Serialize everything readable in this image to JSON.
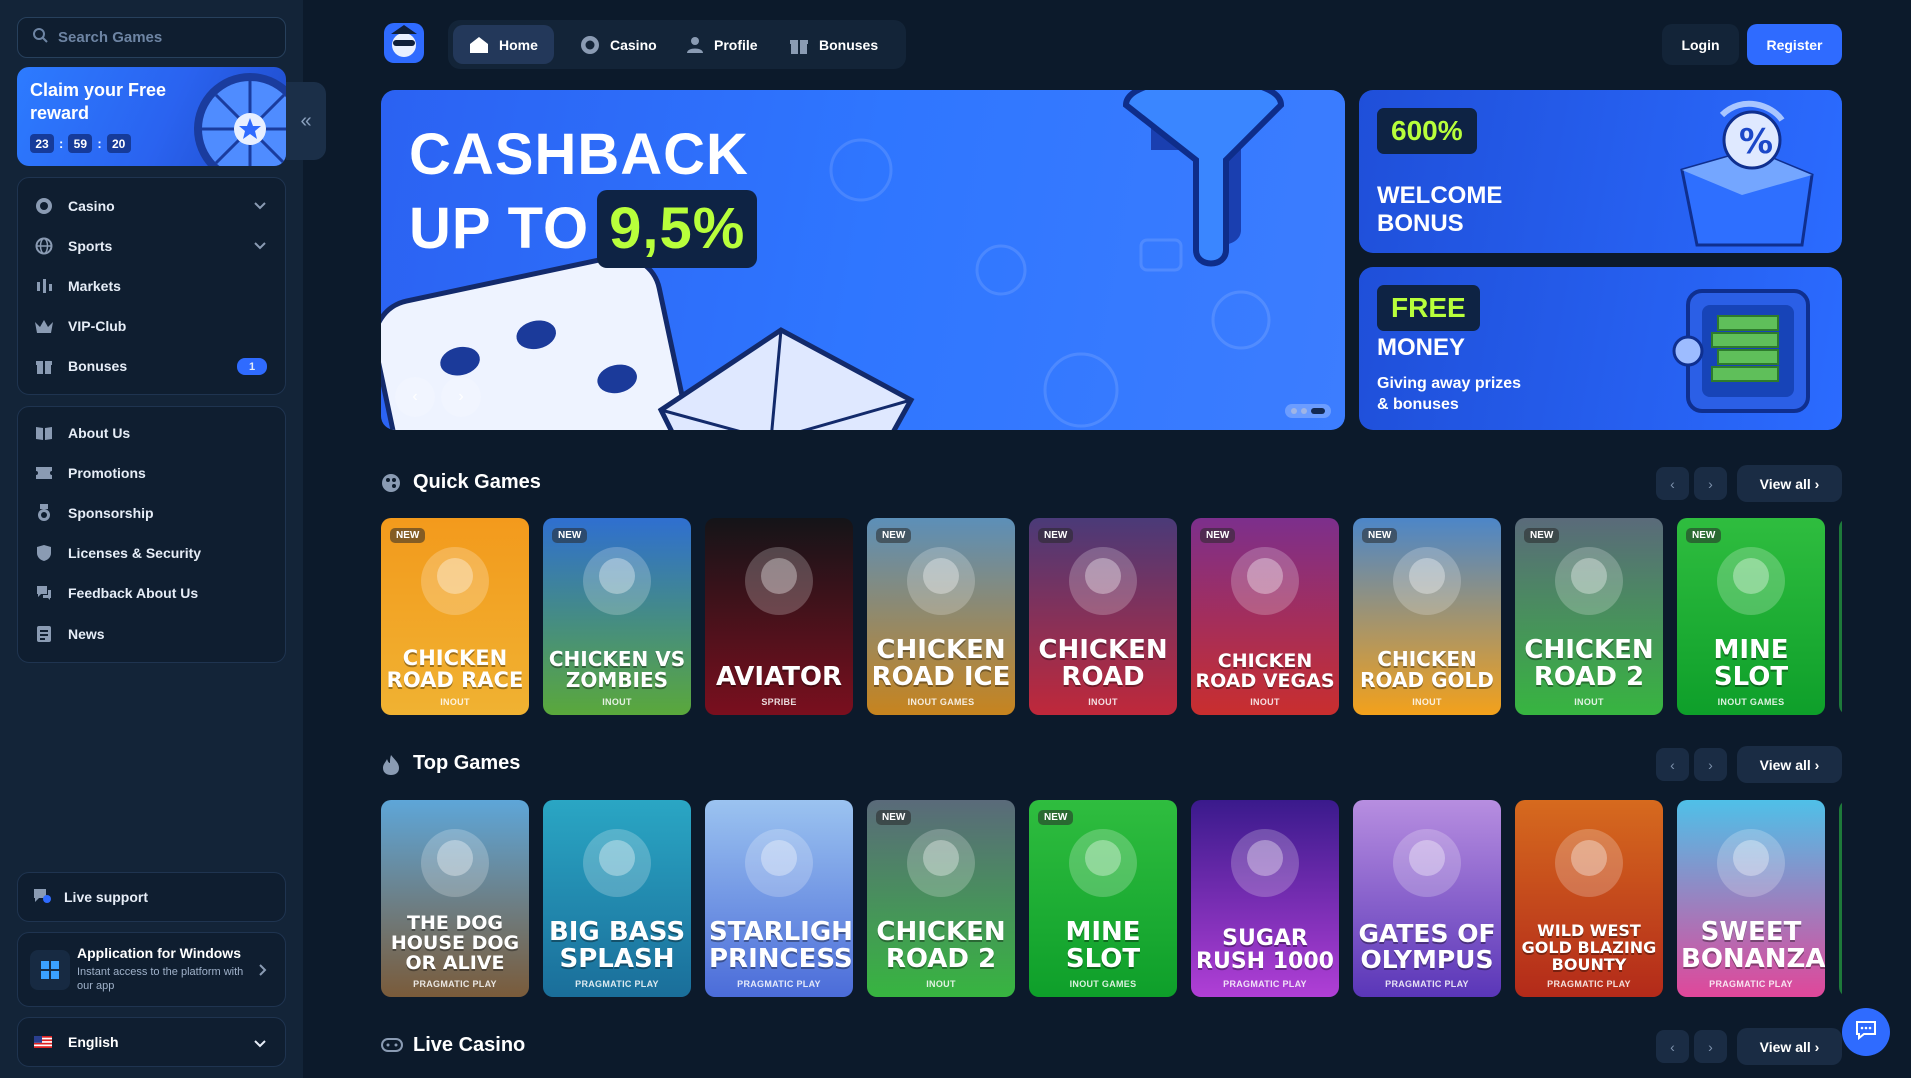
{
  "sidebar": {
    "search_placeholder": "Search Games",
    "reward": {
      "title": "Claim your Free reward",
      "hours": "23",
      "minutes": "59",
      "seconds": "20"
    },
    "main_nav": [
      {
        "label": "Casino",
        "icon": "casino-chip-icon",
        "has_chevron": true
      },
      {
        "label": "Sports",
        "icon": "globe-ball-icon",
        "has_chevron": true
      },
      {
        "label": "Markets",
        "icon": "markets-candles-icon"
      },
      {
        "label": "VIP-Club",
        "icon": "crown-icon"
      },
      {
        "label": "Bonuses",
        "icon": "gift-icon",
        "badge": "1"
      }
    ],
    "info_nav": [
      {
        "label": "About Us",
        "icon": "book-icon"
      },
      {
        "label": "Promotions",
        "icon": "ticket-icon"
      },
      {
        "label": "Sponsorship",
        "icon": "medal-icon"
      },
      {
        "label": "Licenses & Security",
        "icon": "shield-icon"
      },
      {
        "label": "Feedback About Us",
        "icon": "chat-bubbles-icon"
      },
      {
        "label": "News",
        "icon": "newspaper-icon"
      }
    ],
    "live_support": "Live support",
    "app": {
      "title": "Application for Windows",
      "subtitle": "Instant access to the platform with our app"
    },
    "language": "English"
  },
  "topnav": {
    "tabs": [
      {
        "label": "Home",
        "icon": "home-icon",
        "active": true
      },
      {
        "label": "Casino",
        "icon": "casino-chip-icon"
      },
      {
        "label": "Profile",
        "icon": "user-icon"
      },
      {
        "label": "Bonuses",
        "icon": "gift-icon"
      }
    ],
    "login": "Login",
    "register": "Register"
  },
  "hero": {
    "line1": "CASHBACK",
    "line2": "UP TO",
    "highlight": "9,5%"
  },
  "promos": [
    {
      "tag": "600%",
      "title": "WELCOME BONUS"
    },
    {
      "tag": "FREE",
      "title": "MONEY",
      "subtitle": "Giving away prizes & bonuses"
    }
  ],
  "sections": {
    "quick": {
      "title": "Quick Games",
      "view_all": "View all"
    },
    "top": {
      "title": "Top Games",
      "view_all": "View all"
    },
    "live": {
      "title": "Live Casino",
      "view_all": "View all"
    }
  },
  "quick_games": [
    {
      "name": "Chicken Road Race",
      "provider": "INOUT",
      "new": "NEW",
      "bg": "#f39a1c",
      "bg2": "#f0b232"
    },
    {
      "name": "Chicken vs Zombies",
      "provider": "INOUT",
      "new": "NEW",
      "bg": "#2f6fd0",
      "bg2": "#5aa83b"
    },
    {
      "name": "Aviator",
      "provider": "SPRIBE",
      "new": "",
      "bg": "#141418",
      "bg2": "#7a0f1e"
    },
    {
      "name": "Chicken Road Ice",
      "provider": "INOUT GAMES",
      "new": "NEW",
      "bg": "#5c8fb8",
      "bg2": "#c7841e"
    },
    {
      "name": "Chicken Road",
      "provider": "INOUT",
      "new": "NEW",
      "bg": "#4a3a78",
      "bg2": "#c0283a"
    },
    {
      "name": "Chicken Road Vegas",
      "provider": "INOUT",
      "new": "NEW",
      "bg": "#7c2f8c",
      "bg2": "#c92e2e"
    },
    {
      "name": "Chicken Road Gold",
      "provider": "INOUT",
      "new": "NEW",
      "bg": "#4c86c8",
      "bg2": "#f3a11b"
    },
    {
      "name": "Chicken Road 2",
      "provider": "INOUT",
      "new": "NEW",
      "bg": "#5a6a7a",
      "bg2": "#37b540"
    },
    {
      "name": "Mine Slot",
      "provider": "INOUT GAMES",
      "new": "NEW",
      "bg": "#2fbd3f",
      "bg2": "#0e9f2a"
    }
  ],
  "top_games": [
    {
      "name": "The Dog House Dog or Alive",
      "provider": "PRAGMATIC PLAY",
      "new": "",
      "bg": "#5ea6d8",
      "bg2": "#7a5b3a"
    },
    {
      "name": "Big Bass Splash",
      "provider": "PRAGMATIC PLAY",
      "new": "",
      "bg": "#2aa6c4",
      "bg2": "#1a6e9a"
    },
    {
      "name": "Starlight Princess",
      "provider": "PRAGMATIC PLAY",
      "new": "",
      "bg": "#9bc3f0",
      "bg2": "#4b6cd9"
    },
    {
      "name": "Chicken Road 2",
      "provider": "INOUT",
      "new": "NEW",
      "bg": "#5a6a7a",
      "bg2": "#37b540"
    },
    {
      "name": "Mine Slot",
      "provider": "INOUT GAMES",
      "new": "NEW",
      "bg": "#2fbd3f",
      "bg2": "#0e9f2a"
    },
    {
      "name": "Sugar Rush 1000",
      "provider": "PRAGMATIC PLAY",
      "new": "",
      "bg": "#3a1a8c",
      "bg2": "#b03fd6"
    },
    {
      "name": "Gates of Olympus",
      "provider": "PRAGMATIC PLAY",
      "new": "",
      "bg": "#b78ee0",
      "bg2": "#5a36b8"
    },
    {
      "name": "Wild West Gold Blazing Bounty",
      "provider": "PRAGMATIC PLAY",
      "new": "",
      "bg": "#d66a1e",
      "bg2": "#b32a1a"
    },
    {
      "name": "Sweet Bonanza",
      "provider": "PRAGMATIC PLAY",
      "new": "",
      "bg": "#4fc0e8",
      "bg2": "#e0479a"
    }
  ]
}
